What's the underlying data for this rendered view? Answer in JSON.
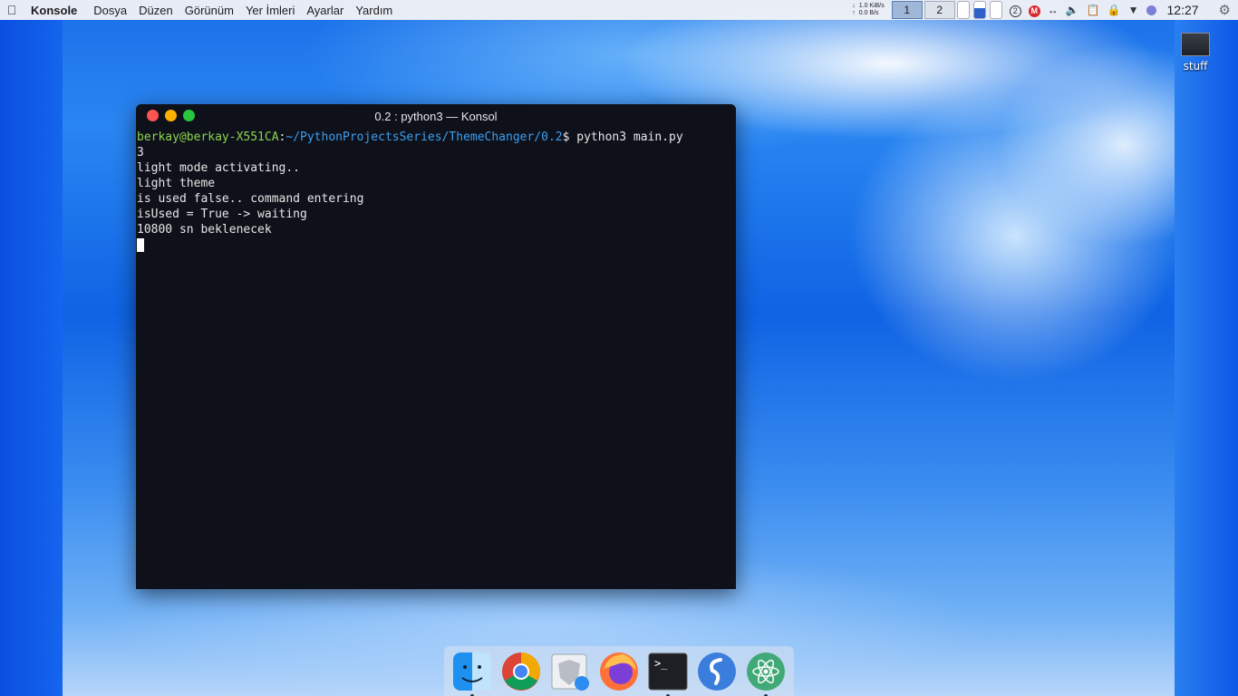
{
  "menubar": {
    "app_name": "Konsole",
    "menus": [
      "Dosya",
      "Düzen",
      "Görünüm",
      "Yer İmleri",
      "Ayarlar",
      "Yardım"
    ],
    "net_down": "1.0 KiB/s",
    "net_up": "0.0 B/s",
    "desktop_1": "1",
    "desktop_2": "2",
    "notification_count": "2",
    "mega_label": "M",
    "clock": "12:27"
  },
  "desktop": {
    "icon_label": "stuff"
  },
  "window": {
    "title": "0.2 : python3 — Konsol",
    "prompt_user": "berkay@berkay-X551CA",
    "prompt_colon": ":",
    "prompt_path": "~/PythonProjectsSeries/ThemeChanger/0.2",
    "prompt_command": "$ python3 main.py",
    "output_lines": [
      "3",
      "light mode activating..",
      "light theme",
      "is used false.. command entering",
      "isUsed = True -> waiting",
      "10800 sn beklenecek"
    ]
  },
  "dock": {
    "items": [
      "finder-icon",
      "chrome-icon",
      "brave-icon",
      "firefox-icon",
      "terminal-icon",
      "simplenote-icon",
      "atom-icon"
    ]
  },
  "colors": {
    "terminal_bg": "#0f111a",
    "prompt_user": "#8bd54f",
    "prompt_path": "#3c9ef0",
    "close": "#fb5452",
    "minimize": "#fcb100",
    "maximize": "#28c63f"
  }
}
